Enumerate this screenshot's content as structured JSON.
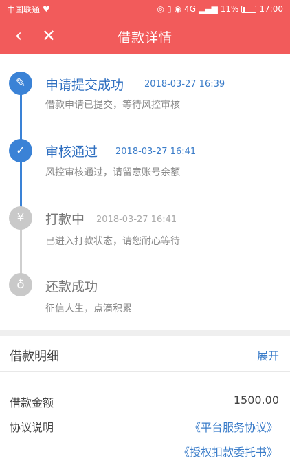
{
  "status_bar": {
    "carrier": "中国联通",
    "signal_text": "4G",
    "battery_pct": "11%",
    "time": "17:00"
  },
  "nav": {
    "back_icon": "‹",
    "close_icon": "✕",
    "title": "借款详情"
  },
  "timeline": {
    "steps": [
      {
        "title": "申请提交成功",
        "time": "2018-03-27 16:39",
        "desc": "借款申请已提交，等待风控审核",
        "icon": "edit-icon",
        "state": "done"
      },
      {
        "title": "审核通过",
        "time": "2018-03-27 16:41",
        "desc": "风控审核通过，请留意账号余额",
        "icon": "check-icon",
        "state": "done"
      },
      {
        "title": "打款中",
        "time": "2018-03-27 16:41",
        "desc": "已进入打款状态，请您耐心等待",
        "icon": "yen-icon",
        "state": "pending"
      },
      {
        "title": "还款成功",
        "time": "",
        "desc": "征信人生，点滴积累",
        "icon": "money-bag-icon",
        "state": "pending"
      }
    ]
  },
  "detail": {
    "title": "借款明细",
    "expand_label": "展开",
    "amount_label": "借款金额",
    "amount_value": "1500.00",
    "agreement_label": "协议说明",
    "agreement_link_1": "《平台服务协议》",
    "agreement_link_2": "《授权扣款委托书》"
  },
  "colors": {
    "brand_red": "#f25b5b",
    "timeline_blue": "#3a82d6",
    "pending_grey": "#c9c9c9"
  }
}
